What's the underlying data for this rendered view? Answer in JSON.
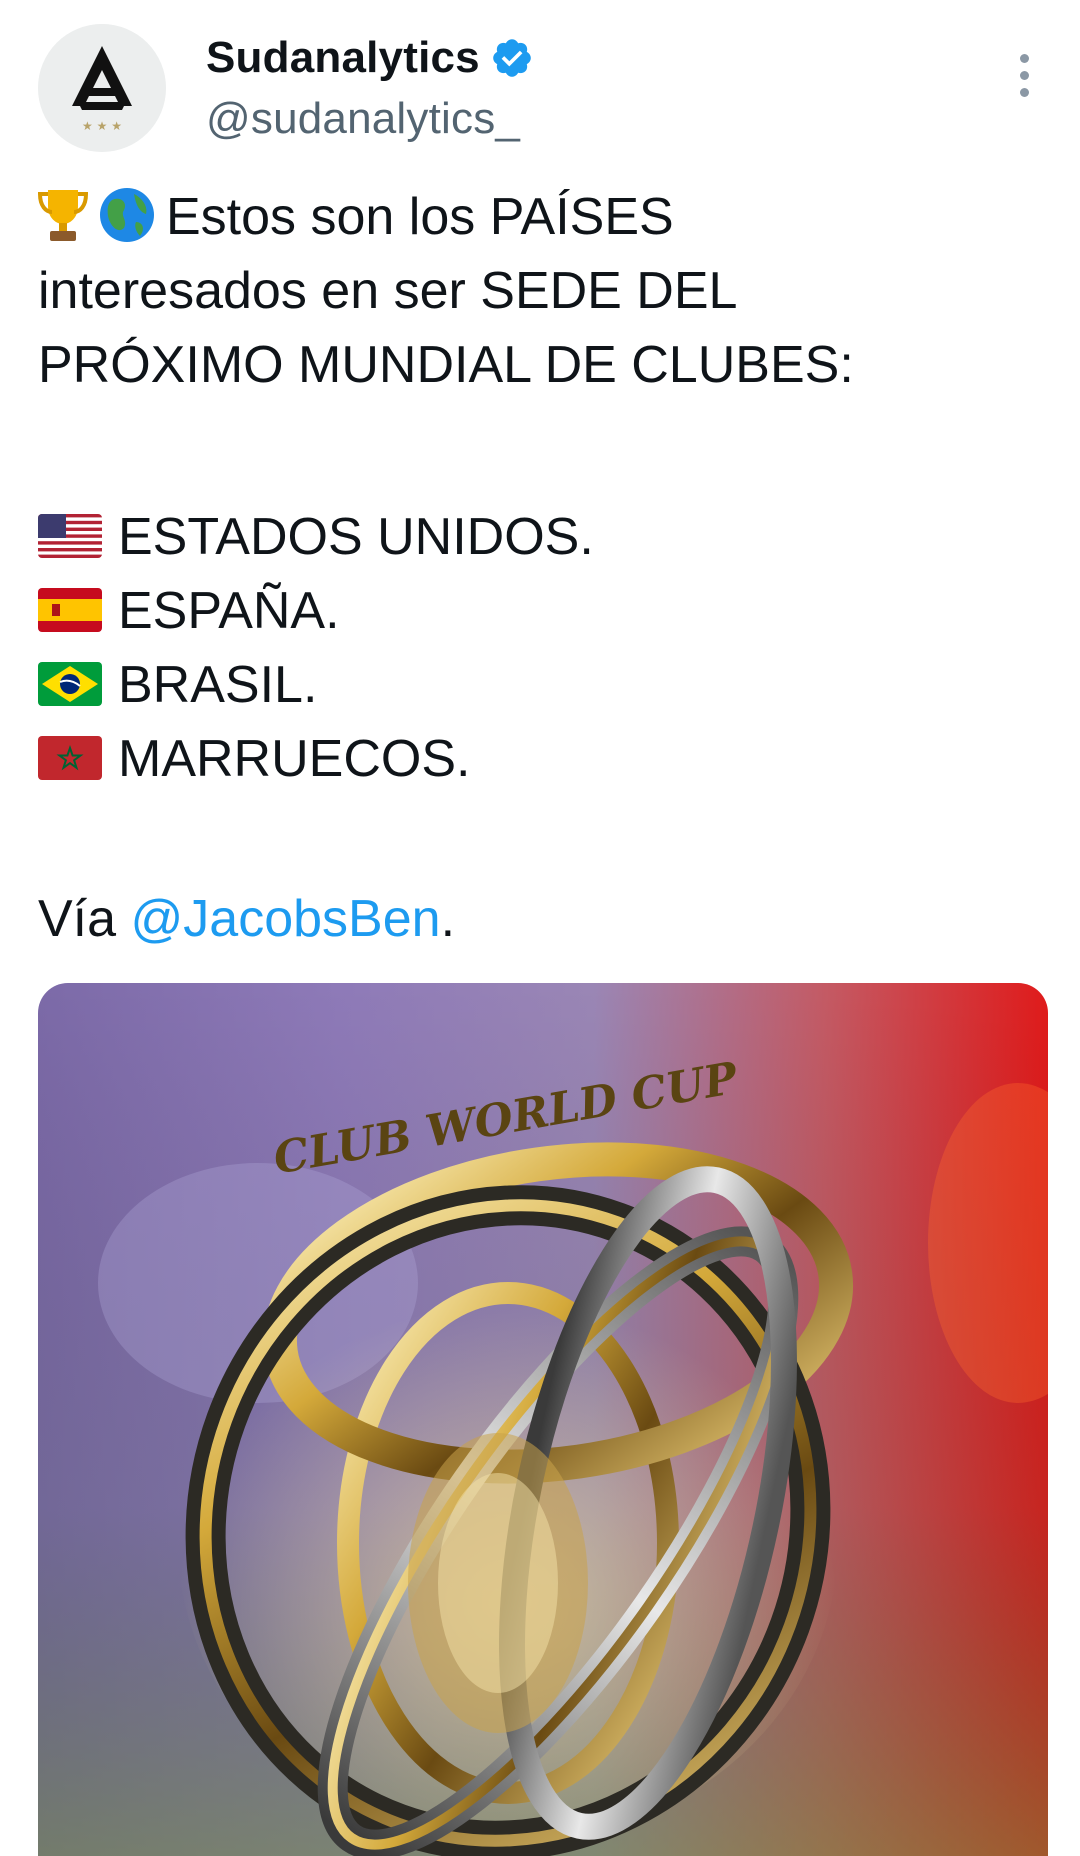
{
  "account": {
    "display_name": "Sudanalytics",
    "handle": "@sudanalytics_",
    "verified": true,
    "avatar_icon": "sudanalytics-logo",
    "more_icon": "more-vertical-icon"
  },
  "tweet": {
    "line1_icons": [
      "trophy-emoji",
      "globe-emoji"
    ],
    "line1": "Estos son los PAÍSES",
    "line2": "interesados en ser SEDE DEL",
    "line3": "PRÓXIMO MUNDIAL DE CLUBES:",
    "countries": [
      {
        "flag": "flag-usa",
        "name": "ESTADOS UNIDOS."
      },
      {
        "flag": "flag-spain",
        "name": "ESPAÑA."
      },
      {
        "flag": "flag-brazil",
        "name": "BRASIL."
      },
      {
        "flag": "flag-morocco",
        "name": "MARRUECOS."
      }
    ],
    "via_label": "Vía ",
    "via_mention": "@JacobsBen",
    "via_suffix": "."
  },
  "media": {
    "description_icon": "club-world-cup-trophy-photo",
    "engraved_text": "CLUB WORLD CUP"
  },
  "colors": {
    "verified_blue": "#1d9bf0",
    "mention_blue": "#1d9bf0",
    "handle_gray": "#536471"
  }
}
